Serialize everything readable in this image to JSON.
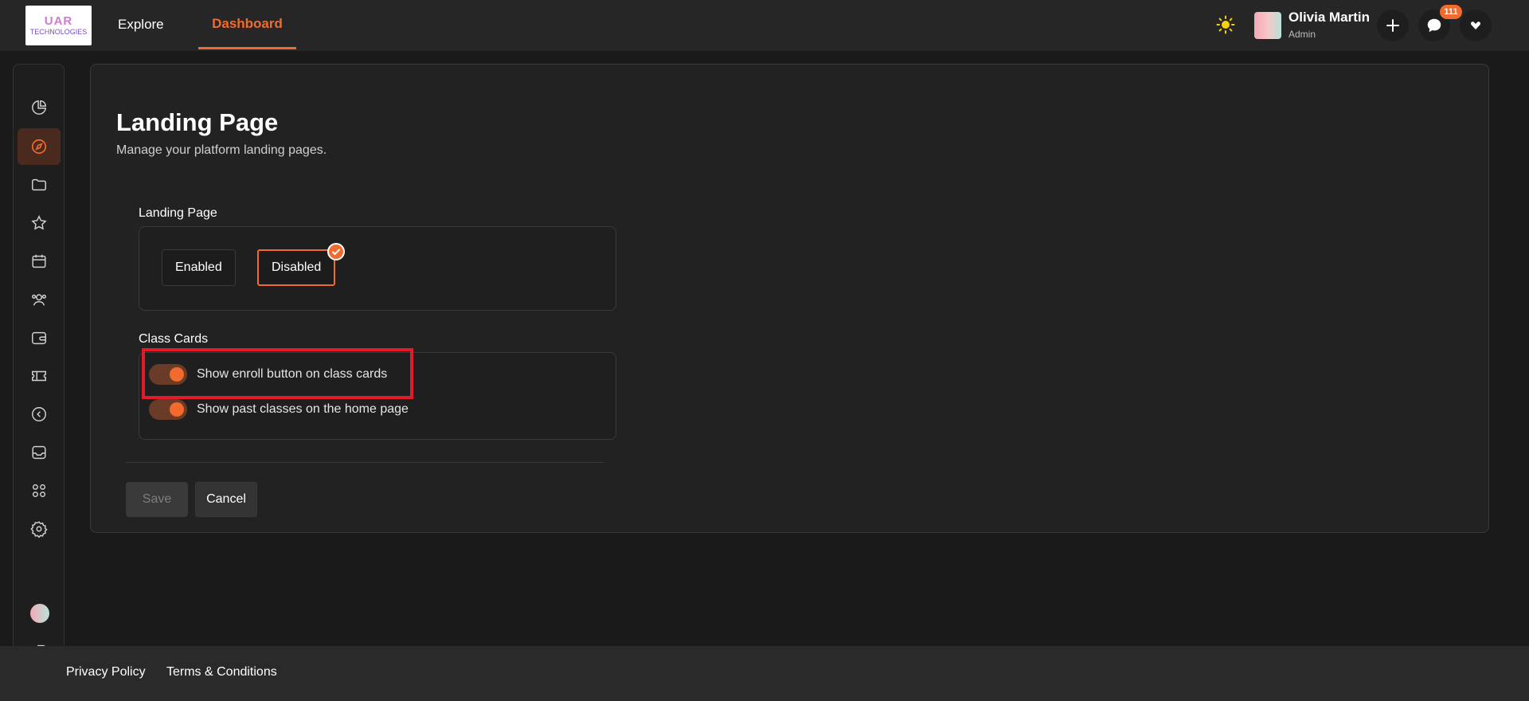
{
  "brand": {
    "logo_line1": "UAR",
    "logo_line2": "TECHNOLOGIES"
  },
  "nav": {
    "explore": "Explore",
    "dashboard": "Dashboard"
  },
  "user": {
    "name": "Olivia Martin",
    "role": "Admin"
  },
  "notifications": {
    "count": "111"
  },
  "sidebar": {
    "items": [
      {
        "icon": "pie-chart-icon",
        "active": false
      },
      {
        "icon": "compass-icon",
        "active": true
      },
      {
        "icon": "folder-icon",
        "active": false
      },
      {
        "icon": "star-icon",
        "active": false
      },
      {
        "icon": "calendar-icon",
        "active": false
      },
      {
        "icon": "users-icon",
        "active": false
      },
      {
        "icon": "wallet-icon",
        "active": false
      },
      {
        "icon": "ticket-icon",
        "active": false
      },
      {
        "icon": "back-circle-icon",
        "active": false
      },
      {
        "icon": "inbox-icon",
        "active": false
      },
      {
        "icon": "apps-icon",
        "active": false
      },
      {
        "icon": "settings-icon",
        "active": false
      }
    ]
  },
  "page": {
    "title": "Landing Page",
    "subtitle": "Manage your platform landing pages."
  },
  "landing_section": {
    "label": "Landing Page",
    "options": [
      "Enabled",
      "Disabled"
    ],
    "selected": "Disabled"
  },
  "class_cards_section": {
    "label": "Class Cards",
    "toggles": [
      {
        "label": "Show enroll button on class cards",
        "on": true
      },
      {
        "label": "Show past classes on the home page",
        "on": true
      }
    ]
  },
  "actions": {
    "save": "Save",
    "cancel": "Cancel"
  },
  "footer": {
    "privacy": "Privacy Policy",
    "terms": "Terms & Conditions"
  },
  "colors": {
    "accent": "#f26a2e",
    "highlight": "#e21b2b",
    "background": "#1a1a1a"
  }
}
